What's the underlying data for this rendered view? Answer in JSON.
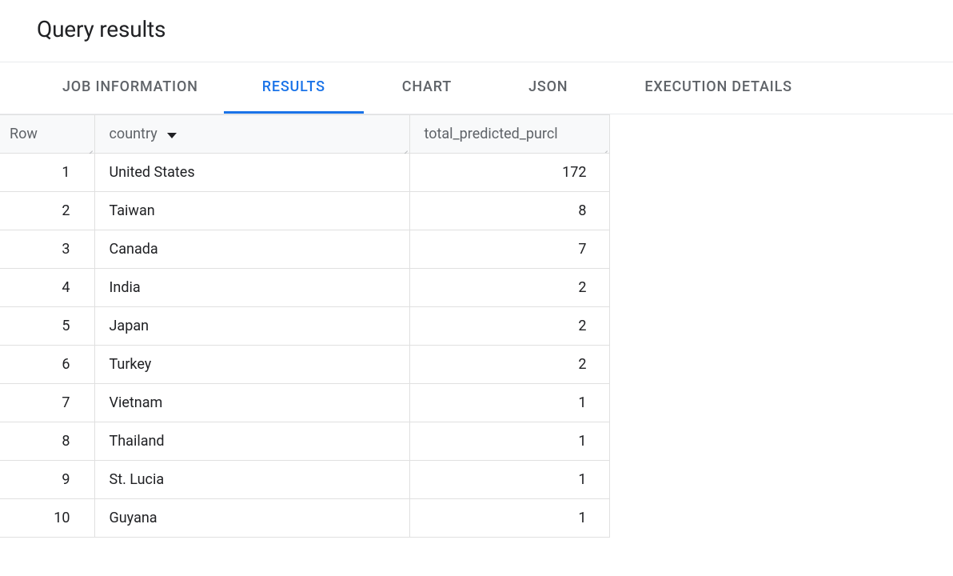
{
  "header": {
    "title": "Query results"
  },
  "tabs": [
    {
      "label": "JOB INFORMATION",
      "id": "job-information",
      "active": false
    },
    {
      "label": "RESULTS",
      "id": "results",
      "active": true
    },
    {
      "label": "CHART",
      "id": "chart",
      "active": false
    },
    {
      "label": "JSON",
      "id": "json",
      "active": false
    },
    {
      "label": "EXECUTION DETAILS",
      "id": "execution-details",
      "active": false
    }
  ],
  "table": {
    "columns": {
      "row": "Row",
      "country": "country",
      "predicted": "total_predicted_purcl"
    },
    "rows": [
      {
        "n": "1",
        "country": "United States",
        "val": "172"
      },
      {
        "n": "2",
        "country": "Taiwan",
        "val": "8"
      },
      {
        "n": "3",
        "country": "Canada",
        "val": "7"
      },
      {
        "n": "4",
        "country": "India",
        "val": "2"
      },
      {
        "n": "5",
        "country": "Japan",
        "val": "2"
      },
      {
        "n": "6",
        "country": "Turkey",
        "val": "2"
      },
      {
        "n": "7",
        "country": "Vietnam",
        "val": "1"
      },
      {
        "n": "8",
        "country": "Thailand",
        "val": "1"
      },
      {
        "n": "9",
        "country": "St. Lucia",
        "val": "1"
      },
      {
        "n": "10",
        "country": "Guyana",
        "val": "1"
      }
    ]
  }
}
